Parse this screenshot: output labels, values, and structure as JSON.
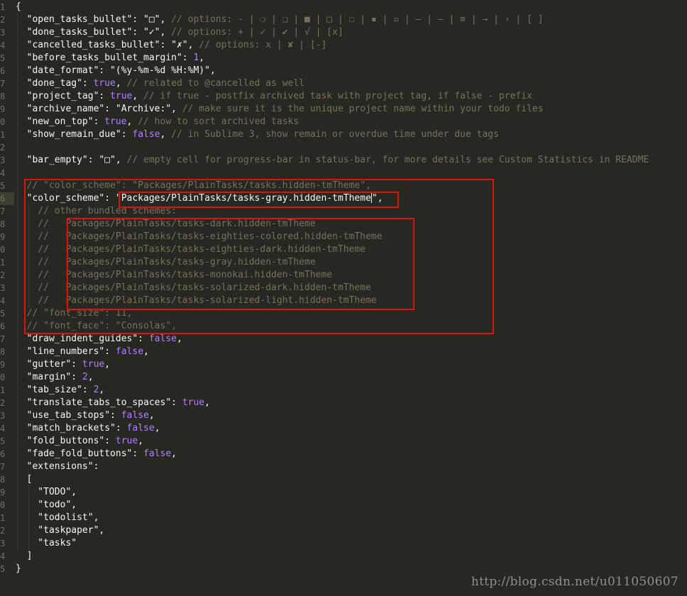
{
  "gutter": {
    "line_numbers": [
      "1",
      "2",
      "3",
      "4",
      "5",
      "6",
      "7",
      "8",
      "9",
      "0",
      "1",
      "2",
      "3",
      "4",
      "5",
      "6",
      "7",
      "8",
      "9",
      "0",
      "1",
      "2",
      "3",
      "4",
      "5",
      "6",
      "7",
      "8",
      "9",
      "0",
      "1",
      "2",
      "3",
      "4",
      "5",
      "6",
      "7",
      "8",
      "9",
      "0",
      "1",
      "2",
      "3",
      "4",
      "5"
    ],
    "active_line_index": 15
  },
  "code_lines": [
    [
      {
        "c": "plain",
        "t": "{"
      }
    ],
    [
      {
        "c": "str",
        "t": "  \"open_tasks_bullet\": \"□\", "
      },
      {
        "c": "cm",
        "t": "// options: - | ❍ | ❑ | ■ | □ | ☐ | ▪ | ▫ | – | — | ≡ | → | › | [ ]"
      }
    ],
    [
      {
        "c": "str",
        "t": "  \"done_tasks_bullet\": \"✓\", "
      },
      {
        "c": "cm",
        "t": "// options: + | ✓ | ✔ | √ | [x]"
      }
    ],
    [
      {
        "c": "str",
        "t": "  \"cancelled_tasks_bullet\": \"✗\", "
      },
      {
        "c": "cm",
        "t": "// options: x | ✘ | [-]"
      }
    ],
    [
      {
        "c": "str",
        "t": "  \"before_tasks_bullet_margin\": "
      },
      {
        "c": "kw",
        "t": "1"
      },
      {
        "c": "plain",
        "t": ","
      }
    ],
    [
      {
        "c": "str",
        "t": "  \"date_format\": \"(%y-%m-%d %H:%M)\","
      }
    ],
    [
      {
        "c": "str",
        "t": "  \"done_tag\": "
      },
      {
        "c": "kw",
        "t": "true"
      },
      {
        "c": "plain",
        "t": ", "
      },
      {
        "c": "cm",
        "t": "// related to @cancelled as well"
      }
    ],
    [
      {
        "c": "str",
        "t": "  \"project_tag\": "
      },
      {
        "c": "kw",
        "t": "true"
      },
      {
        "c": "plain",
        "t": ", "
      },
      {
        "c": "cm",
        "t": "// if true - postfix archived task with project tag, if false - prefix"
      }
    ],
    [
      {
        "c": "str",
        "t": "  \"archive_name\": \"Archive:\", "
      },
      {
        "c": "cm",
        "t": "// make sure it is the unique project name within your todo files"
      }
    ],
    [
      {
        "c": "str",
        "t": "  \"new_on_top\": "
      },
      {
        "c": "kw",
        "t": "true"
      },
      {
        "c": "plain",
        "t": ", "
      },
      {
        "c": "cm",
        "t": "// how to sort archived tasks"
      }
    ],
    [
      {
        "c": "str",
        "t": "  \"show_remain_due\": "
      },
      {
        "c": "kw",
        "t": "false"
      },
      {
        "c": "plain",
        "t": ", "
      },
      {
        "c": "cm",
        "t": "// in Sublime 3, show remain or overdue time under due tags"
      }
    ],
    [],
    [
      {
        "c": "str",
        "t": "  \"bar_empty\": \"□\", "
      },
      {
        "c": "cm",
        "t": "// empty cell for progress-bar in status-bar, for more details see Custom Statistics in README"
      }
    ],
    [],
    [
      {
        "c": "cm",
        "t": "  // \"color_scheme\": \"Packages/PlainTasks/tasks.hidden-tmTheme\","
      }
    ],
    [
      {
        "c": "str",
        "t": "  \"color_scheme\": \"Packages/PlainTasks/tasks-gray.hidden-tmTheme"
      },
      {
        "c": "caret",
        "t": ""
      },
      {
        "c": "str",
        "t": "\","
      }
    ],
    [
      {
        "c": "cm",
        "t": "    // other bundled schemes:"
      }
    ],
    [
      {
        "c": "cm",
        "t": "    //   Packages/PlainTasks/tasks-dark.hidden-tmTheme"
      }
    ],
    [
      {
        "c": "cm",
        "t": "    //   Packages/PlainTasks/tasks-eighties-colored.hidden-tmTheme"
      }
    ],
    [
      {
        "c": "cm",
        "t": "    //   Packages/PlainTasks/tasks-eighties-dark.hidden-tmTheme"
      }
    ],
    [
      {
        "c": "cm",
        "t": "    //   Packages/PlainTasks/tasks-gray.hidden-tmTheme"
      }
    ],
    [
      {
        "c": "cm",
        "t": "    //   Packages/PlainTasks/tasks-monokai.hidden-tmTheme"
      }
    ],
    [
      {
        "c": "cm",
        "t": "    //   Packages/PlainTasks/tasks-solarized-dark.hidden-tmTheme"
      }
    ],
    [
      {
        "c": "cm",
        "t": "    //   Packages/PlainTasks/tasks-solarized-light.hidden-tmTheme"
      }
    ],
    [
      {
        "c": "cm",
        "t": "  // \"font_size\": 11,"
      }
    ],
    [
      {
        "c": "cm",
        "t": "  // \"font_face\": \"Consolas\","
      }
    ],
    [
      {
        "c": "str",
        "t": "  \"draw_indent_guides\": "
      },
      {
        "c": "kw",
        "t": "false"
      },
      {
        "c": "plain",
        "t": ","
      }
    ],
    [
      {
        "c": "str",
        "t": "  \"line_numbers\": "
      },
      {
        "c": "kw",
        "t": "false"
      },
      {
        "c": "plain",
        "t": ","
      }
    ],
    [
      {
        "c": "str",
        "t": "  \"gutter\": "
      },
      {
        "c": "kw",
        "t": "true"
      },
      {
        "c": "plain",
        "t": ","
      }
    ],
    [
      {
        "c": "str",
        "t": "  \"margin\": "
      },
      {
        "c": "kw",
        "t": "2"
      },
      {
        "c": "plain",
        "t": ","
      }
    ],
    [
      {
        "c": "str",
        "t": "  \"tab_size\": "
      },
      {
        "c": "kw",
        "t": "2"
      },
      {
        "c": "plain",
        "t": ","
      }
    ],
    [
      {
        "c": "str",
        "t": "  \"translate_tabs_to_spaces\": "
      },
      {
        "c": "kw",
        "t": "true"
      },
      {
        "c": "plain",
        "t": ","
      }
    ],
    [
      {
        "c": "str",
        "t": "  \"use_tab_stops\": "
      },
      {
        "c": "kw",
        "t": "false"
      },
      {
        "c": "plain",
        "t": ","
      }
    ],
    [
      {
        "c": "str",
        "t": "  \"match_brackets\": "
      },
      {
        "c": "kw",
        "t": "false"
      },
      {
        "c": "plain",
        "t": ","
      }
    ],
    [
      {
        "c": "str",
        "t": "  \"fold_buttons\": "
      },
      {
        "c": "kw",
        "t": "true"
      },
      {
        "c": "plain",
        "t": ","
      }
    ],
    [
      {
        "c": "str",
        "t": "  \"fade_fold_buttons\": "
      },
      {
        "c": "kw",
        "t": "false"
      },
      {
        "c": "plain",
        "t": ","
      }
    ],
    [
      {
        "c": "str",
        "t": "  \"extensions\":"
      }
    ],
    [
      {
        "c": "plain",
        "t": "  ["
      }
    ],
    [
      {
        "c": "str",
        "t": "    \"TODO\","
      }
    ],
    [
      {
        "c": "str",
        "t": "    \"todo\","
      }
    ],
    [
      {
        "c": "str",
        "t": "    \"todolist\","
      }
    ],
    [
      {
        "c": "str",
        "t": "    \"taskpaper\","
      }
    ],
    [
      {
        "c": "str",
        "t": "    \"tasks\""
      }
    ],
    [
      {
        "c": "plain",
        "t": "  ]"
      }
    ],
    [
      {
        "c": "plain",
        "t": "}"
      }
    ]
  ],
  "colors": {
    "background": "#272822",
    "comment": "#75715e",
    "constant": "#ae81ff",
    "text": "#f8f8f2",
    "highlight_box": "#e01010"
  },
  "watermark": "http://blog.csdn.net/u011050607"
}
